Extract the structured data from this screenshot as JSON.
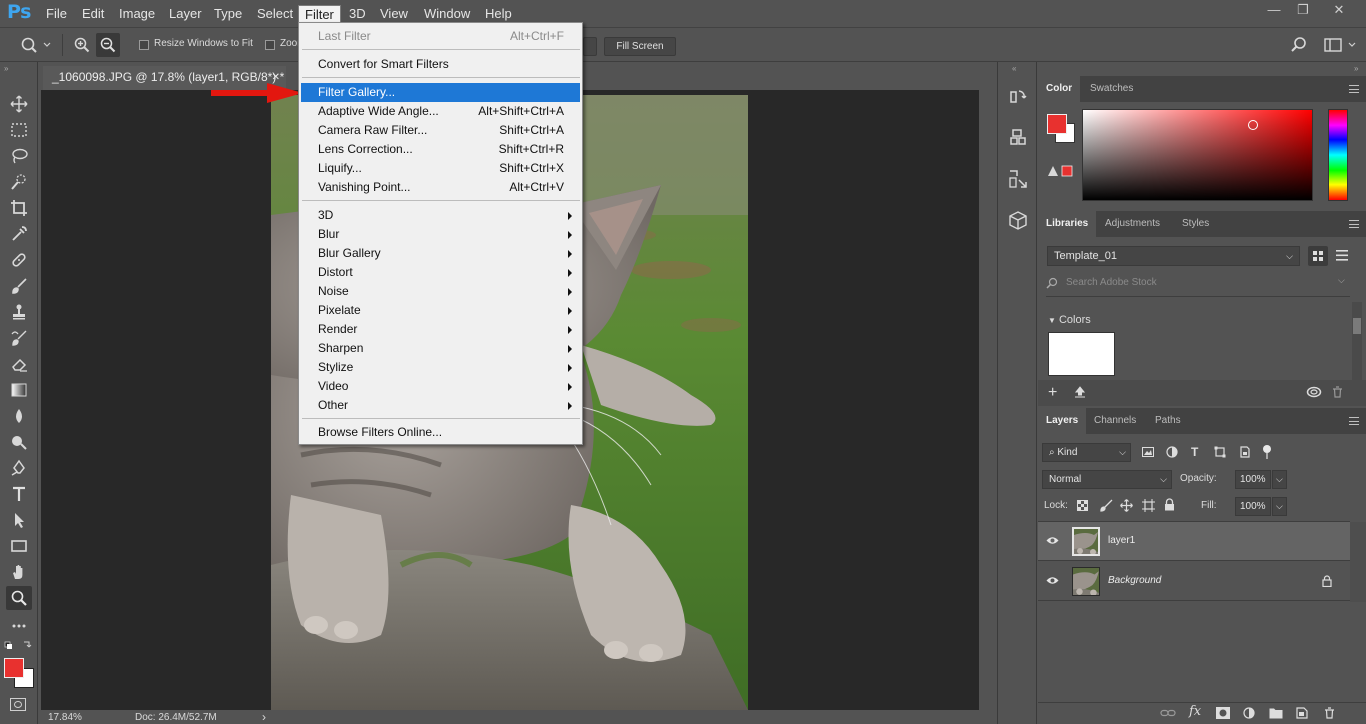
{
  "app": {
    "logo": "Ps"
  },
  "menubar": {
    "items": [
      "File",
      "Edit",
      "Image",
      "Layer",
      "Type",
      "Select",
      "Filter",
      "3D",
      "View",
      "Window",
      "Help"
    ],
    "active": "Filter"
  },
  "window_controls": {
    "minimize": "—",
    "restore": "❐",
    "close": "✕"
  },
  "options_bar": {
    "resize_windows_label": "Resize Windows to Fit",
    "zoom_all_label": "Zoom",
    "fill_screen_label": "Fill Screen"
  },
  "document": {
    "tab_title": "_1060098.JPG @ 17.8% (layer1, RGB/8*) *",
    "tab_close": "✕"
  },
  "status_bar": {
    "zoom": "17.84%",
    "doc_size": "Doc: 26.4M/52.7M",
    "arrow": "›"
  },
  "filter_menu": {
    "last_filter": {
      "label": "Last Filter",
      "shortcut": "Alt+Ctrl+F"
    },
    "convert_smart": {
      "label": "Convert for Smart Filters"
    },
    "gallery_items": [
      {
        "label": "Filter Gallery...",
        "shortcut": ""
      },
      {
        "label": "Adaptive Wide Angle...",
        "shortcut": "Alt+Shift+Ctrl+A"
      },
      {
        "label": "Camera Raw Filter...",
        "shortcut": "Shift+Ctrl+A"
      },
      {
        "label": "Lens Correction...",
        "shortcut": "Shift+Ctrl+R"
      },
      {
        "label": "Liquify...",
        "shortcut": "Shift+Ctrl+X"
      },
      {
        "label": "Vanishing Point...",
        "shortcut": "Alt+Ctrl+V"
      }
    ],
    "submenus": [
      "3D",
      "Blur",
      "Blur Gallery",
      "Distort",
      "Noise",
      "Pixelate",
      "Render",
      "Sharpen",
      "Stylize",
      "Video",
      "Other"
    ],
    "browse_online": {
      "label": "Browse Filters Online..."
    }
  },
  "color_panel": {
    "tabs": [
      "Color",
      "Swatches"
    ],
    "foreground": "#e8312f",
    "background": "#ffffff",
    "hue_color": "#ff0000"
  },
  "libraries_panel": {
    "tabs": [
      "Libraries",
      "Adjustments",
      "Styles"
    ],
    "library_select": "Template_01",
    "search_placeholder": "Search Adobe Stock",
    "section_title": "Colors"
  },
  "layers_panel": {
    "tabs": [
      "Layers",
      "Channels",
      "Paths"
    ],
    "filter_kind": "Kind",
    "blend_mode": "Normal",
    "opacity_label": "Opacity:",
    "opacity_value": "100%",
    "lock_label": "Lock:",
    "fill_label": "Fill:",
    "fill_value": "100%",
    "layers": [
      {
        "name": "layer1",
        "selected": true
      },
      {
        "name": "Background",
        "selected": false,
        "locked": true
      }
    ]
  },
  "icons": {
    "toolbar": [
      "move-icon",
      "marquee-icon",
      "lasso-icon",
      "quick-select-icon",
      "crop-icon",
      "eyedropper-icon",
      "healing-icon",
      "brush-icon",
      "stamp-icon",
      "history-brush-icon",
      "eraser-icon",
      "gradient-icon",
      "blur-icon",
      "dodge-icon",
      "pen-icon",
      "type-icon",
      "path-select-icon",
      "rectangle-icon",
      "hand-icon",
      "zoom-icon",
      "more-tools-icon"
    ]
  },
  "colors": {
    "ui_bg": "#535353",
    "canvas_bg": "#282828",
    "menu_highlight": "#1e78d6",
    "annotation_arrow": "#e3170f"
  }
}
